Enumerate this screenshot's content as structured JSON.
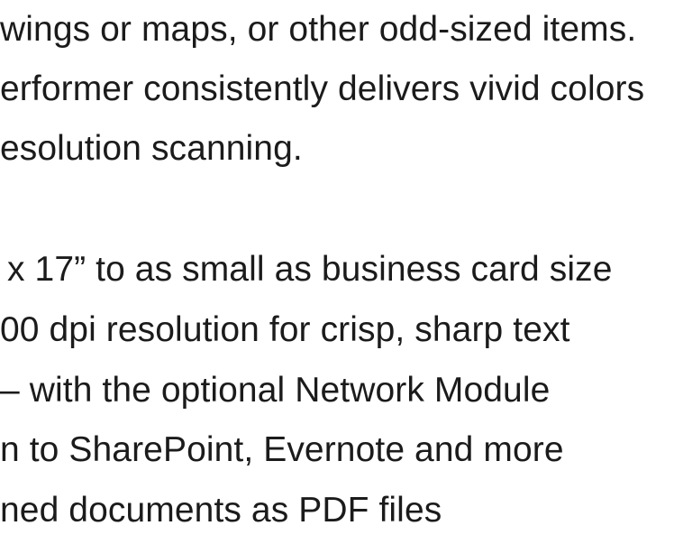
{
  "paragraph": {
    "lines": [
      "wings or maps, or other odd-sized items.",
      "erformer consistently delivers vivid colors",
      "esolution scanning."
    ]
  },
  "features": {
    "lines": [
      "x 17” to as small as business card size",
      "00 dpi resolution for crisp, sharp text",
      "– with the optional Network Module",
      "n to SharePoint, Evernote and more",
      "ned documents as PDF files"
    ]
  }
}
